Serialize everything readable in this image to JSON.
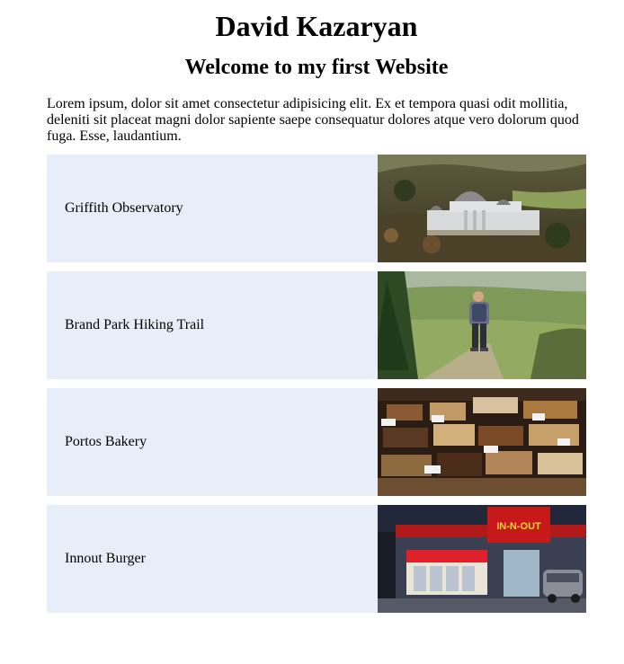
{
  "header": {
    "title": "David Kazaryan",
    "subtitle": "Welcome to my first Website"
  },
  "intro": {
    "text": "Lorem ipsum, dolor sit amet consectetur adipisicing elit. Ex et tempora quasi odit mollitia, deleniti sit placeat magni dolor sapiente saepe consequatur dolores atque vero dolorum quod fuga. Esse, laudantium."
  },
  "cards": [
    {
      "label": "Griffith Observatory",
      "image": "griffith-observatory-photo"
    },
    {
      "label": "Brand Park Hiking Trail",
      "image": "hiking-trail-photo"
    },
    {
      "label": "Portos Bakery",
      "image": "bakery-pastries-photo"
    },
    {
      "label": "Innout Burger",
      "image": "in-n-out-restaurant-photo",
      "sign_text": "IN-N-OUT"
    }
  ],
  "colors": {
    "card_background": "#e8eef7",
    "text": "#000000"
  }
}
